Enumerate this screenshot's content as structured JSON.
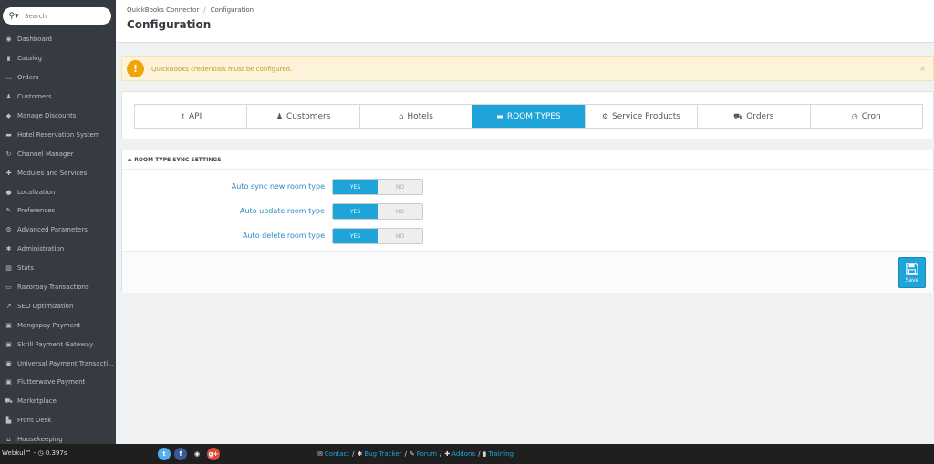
{
  "search": {
    "placeholder": "Search",
    "icon": "search-icon"
  },
  "sidebar": {
    "items": [
      {
        "label": "Dashboard",
        "icon": "dashboard-icon",
        "glyph": "◉"
      },
      {
        "label": "Catalog",
        "icon": "book-icon",
        "glyph": "▮"
      },
      {
        "label": "Orders",
        "icon": "credit-card-icon",
        "glyph": "▭"
      },
      {
        "label": "Customers",
        "icon": "users-icon",
        "glyph": "♟"
      },
      {
        "label": "Manage Discounts",
        "icon": "tag-icon",
        "glyph": "◆"
      },
      {
        "label": "Hotel Reservation System",
        "icon": "bed-icon",
        "glyph": "▬"
      },
      {
        "label": "Channel Manager",
        "icon": "refresh-icon",
        "glyph": "↻"
      },
      {
        "label": "Modules and Services",
        "icon": "puzzle-icon",
        "glyph": "✚"
      },
      {
        "label": "Localization",
        "icon": "globe-icon",
        "glyph": "●"
      },
      {
        "label": "Preferences",
        "icon": "wrench-icon",
        "glyph": "✎"
      },
      {
        "label": "Advanced Parameters",
        "icon": "cogs-icon",
        "glyph": "⚙"
      },
      {
        "label": "Administration",
        "icon": "cog-icon",
        "glyph": "✱"
      },
      {
        "label": "Stats",
        "icon": "bar-chart-icon",
        "glyph": "▥"
      },
      {
        "label": "Razorpay Transactions",
        "icon": "credit-card-icon",
        "glyph": "▭"
      },
      {
        "label": "SEO Optimization",
        "icon": "line-chart-icon",
        "glyph": "↗"
      },
      {
        "label": "Mangopay Payment",
        "icon": "money-icon",
        "glyph": "▣"
      },
      {
        "label": "Skrill Payment Gateway",
        "icon": "money-icon",
        "glyph": "▣"
      },
      {
        "label": "Universal Payment Transacti...",
        "icon": "money-icon",
        "glyph": "▣"
      },
      {
        "label": "Flutterwave Payment",
        "icon": "money-icon",
        "glyph": "▣"
      },
      {
        "label": "Marketplace",
        "icon": "cart-icon",
        "glyph": "⛟"
      },
      {
        "label": "Front Desk",
        "icon": "building-icon",
        "glyph": "▙"
      },
      {
        "label": "Housekeeping",
        "icon": "home-icon",
        "glyph": "⌂"
      }
    ]
  },
  "header": {
    "breadcrumb_parent": "QuickBooks Connector",
    "breadcrumb_sep": "/",
    "breadcrumb_current": "Configuration",
    "title": "Configuration"
  },
  "alert": {
    "icon_text": "!",
    "message": "QuickBooks credentials must be configured.",
    "close": "×"
  },
  "tabs": [
    {
      "label": "API",
      "icon": "key-icon",
      "glyph": "⚷",
      "active": false
    },
    {
      "label": "Customers",
      "icon": "user-icon",
      "glyph": "♟",
      "active": false
    },
    {
      "label": "Hotels",
      "icon": "home-icon",
      "glyph": "⌂",
      "active": false
    },
    {
      "label": "ROOM TYPES",
      "icon": "bed-icon",
      "glyph": "▬",
      "active": true
    },
    {
      "label": "Service Products",
      "icon": "cogs-icon",
      "glyph": "⚙",
      "active": false
    },
    {
      "label": "Orders",
      "icon": "cart-icon",
      "glyph": "⛟",
      "active": false
    },
    {
      "label": "Cron",
      "icon": "clock-icon",
      "glyph": "◷",
      "active": false
    }
  ],
  "settings": {
    "heading": "ROOM TYPE SYNC SETTINGS",
    "heading_icon": "home-icon",
    "rows": [
      {
        "label": "Auto sync new room type",
        "yes": "YES",
        "no": "NO",
        "value": "YES"
      },
      {
        "label": "Auto update room type",
        "yes": "YES",
        "no": "NO",
        "value": "YES"
      },
      {
        "label": "Auto delete room type",
        "yes": "YES",
        "no": "NO",
        "value": "YES"
      }
    ],
    "save_label": "Save"
  },
  "footer": {
    "brand": "Webkul™ - ",
    "time": "0.397s",
    "social": [
      {
        "name": "twitter-icon",
        "glyph": "t",
        "color": "#55acee"
      },
      {
        "name": "facebook-icon",
        "glyph": "f",
        "color": "#3b5998"
      },
      {
        "name": "github-icon",
        "glyph": "◉",
        "color": "#222222"
      },
      {
        "name": "google-plus-icon",
        "glyph": "g+",
        "color": "#dd4b39"
      }
    ],
    "links": [
      {
        "label": "Contact",
        "icon": "envelope-icon",
        "glyph": "✉"
      },
      {
        "label": "Bug Tracker",
        "icon": "bug-icon",
        "glyph": "✱"
      },
      {
        "label": "Forum",
        "icon": "comments-icon",
        "glyph": "✎"
      },
      {
        "label": "Addons",
        "icon": "puzzle-icon",
        "glyph": "✚"
      },
      {
        "label": "Training",
        "icon": "book-icon",
        "glyph": "▮"
      }
    ]
  },
  "colors": {
    "accent": "#1ea4d8",
    "sidebar": "#363a41",
    "alert_bg": "#fcf3d8",
    "footer": "#1f1f1f"
  }
}
